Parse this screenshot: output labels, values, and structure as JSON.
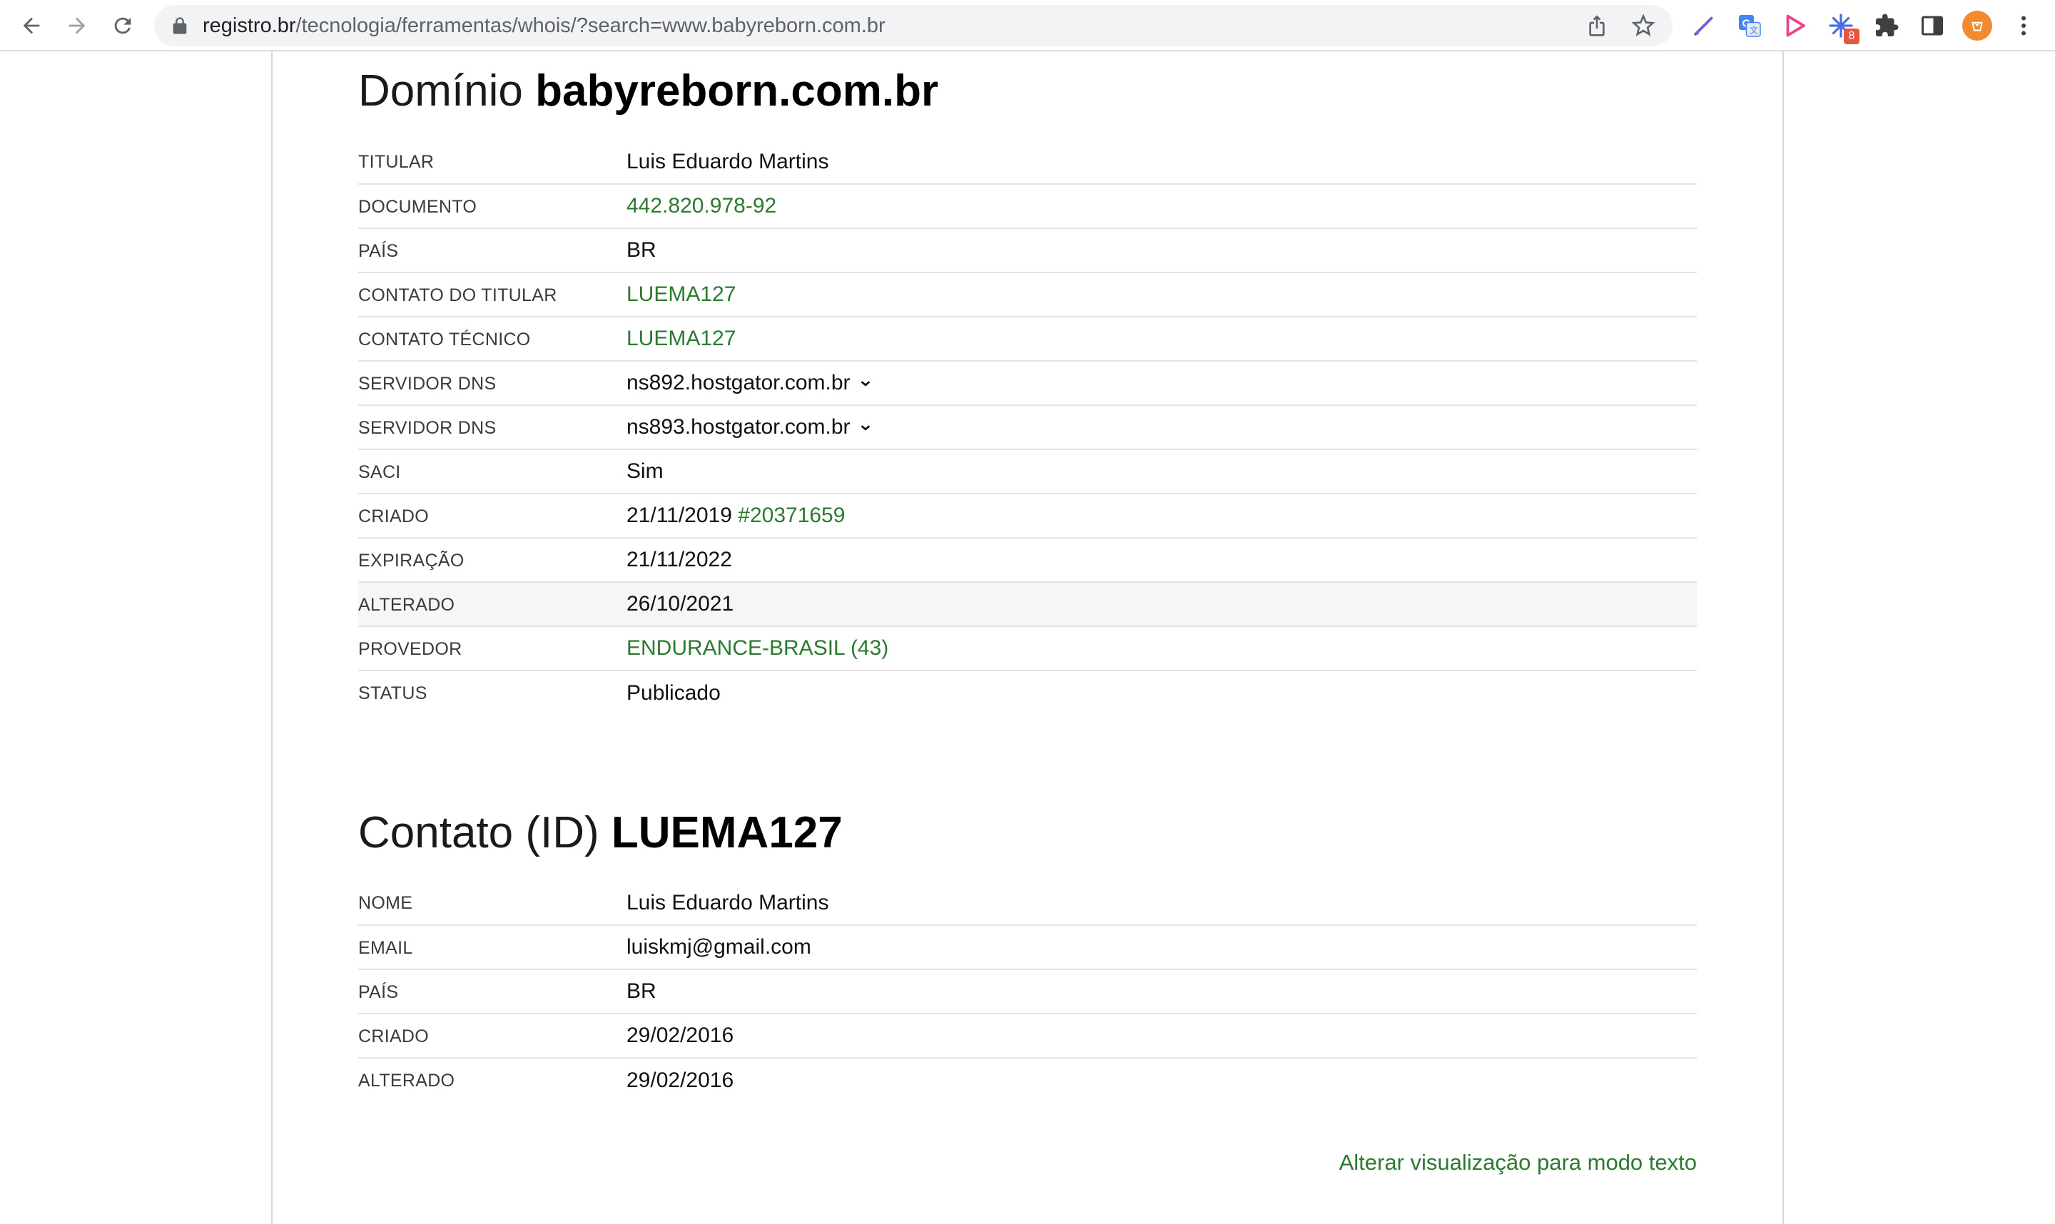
{
  "browser": {
    "url_host": "registro.br",
    "url_path": "/tecnologia/ferramentas/whois/?search=www.babyreborn.com.br",
    "extension_badge": "8"
  },
  "domain_section": {
    "title_prefix": "Domínio",
    "title_value": "babyreborn.com.br",
    "rows": [
      {
        "label": "TITULAR",
        "value": "Luis Eduardo Martins"
      },
      {
        "label": "DOCUMENTO",
        "value": "442.820.978-92"
      },
      {
        "label": "PAÍS",
        "value": "BR"
      },
      {
        "label": "CONTATO DO TITULAR",
        "value": "LUEMA127"
      },
      {
        "label": "CONTATO TÉCNICO",
        "value": "LUEMA127"
      },
      {
        "label": "SERVIDOR DNS",
        "value": "ns892.hostgator.com.br"
      },
      {
        "label": "SERVIDOR DNS",
        "value": "ns893.hostgator.com.br"
      },
      {
        "label": "SACI",
        "value": "Sim"
      },
      {
        "label": "CRIADO",
        "value": "21/11/2019",
        "extra": "#20371659"
      },
      {
        "label": "EXPIRAÇÃO",
        "value": "21/11/2022"
      },
      {
        "label": "ALTERADO",
        "value": "26/10/2021"
      },
      {
        "label": "PROVEDOR",
        "value": "ENDURANCE-BRASIL (43)"
      },
      {
        "label": "STATUS",
        "value": "Publicado"
      }
    ]
  },
  "contact_section": {
    "title_prefix": "Contato (ID)",
    "title_value": "LUEMA127",
    "rows": [
      {
        "label": "NOME",
        "value": "Luis Eduardo Martins"
      },
      {
        "label": "EMAIL",
        "value": "luiskmj@gmail.com"
      },
      {
        "label": "PAÍS",
        "value": "BR"
      },
      {
        "label": "CRIADO",
        "value": "29/02/2016"
      },
      {
        "label": "ALTERADO",
        "value": "29/02/2016"
      }
    ]
  },
  "footer": {
    "text_mode_link": "Alterar visualização para modo texto"
  },
  "colors": {
    "link_green": "#2b7a2f",
    "row_highlight": "#f5f6f5"
  }
}
